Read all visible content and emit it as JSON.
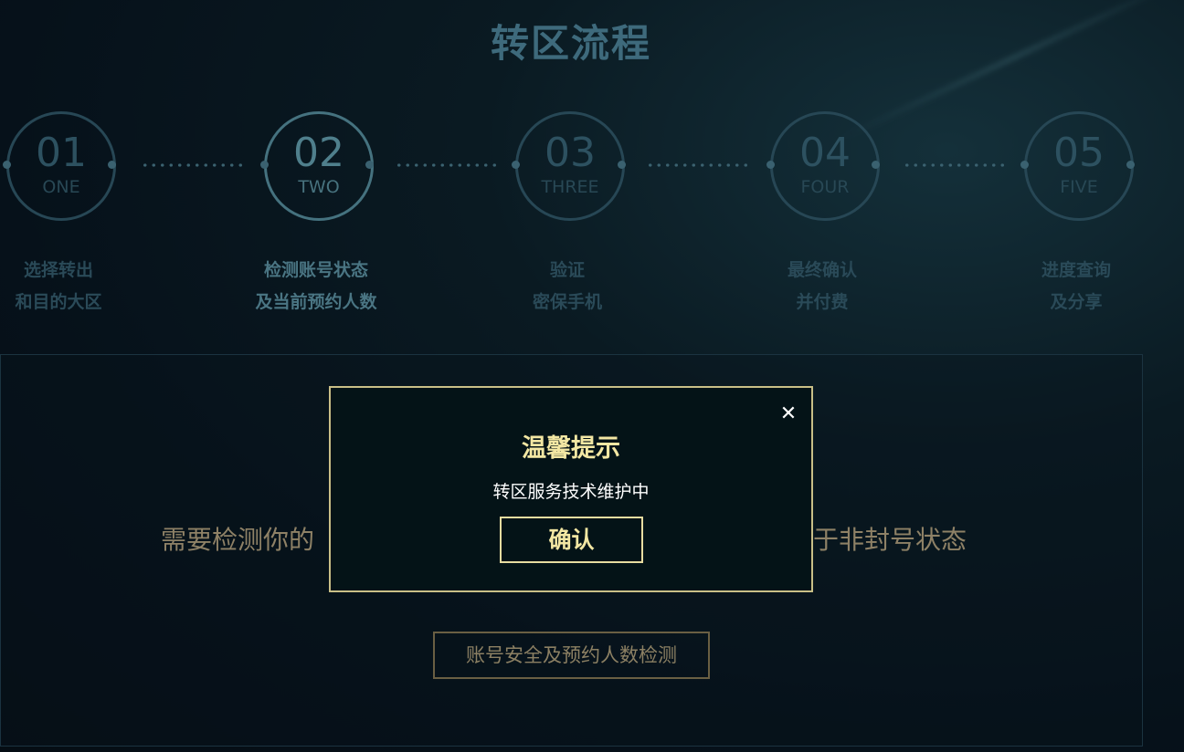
{
  "page": {
    "title": "转区流程"
  },
  "steps": [
    {
      "num": "01",
      "word": "ONE",
      "line1": "选择转出",
      "line2": "和目的大区"
    },
    {
      "num": "02",
      "word": "TWO",
      "line1": "检测账号状态",
      "line2": "及当前预约人数"
    },
    {
      "num": "03",
      "word": "THREE",
      "line1": "验证",
      "line2": "密保手机"
    },
    {
      "num": "04",
      "word": "FOUR",
      "line1": "最终确认",
      "line2": "并付费"
    },
    {
      "num": "05",
      "word": "FIVE",
      "line1": "进度查询",
      "line2": "及分享"
    }
  ],
  "panel": {
    "text_left": "需要检测你的",
    "text_right": "于非封号状态",
    "check_button": "账号安全及预约人数检测"
  },
  "modal": {
    "title": "温馨提示",
    "message": "转区服务技术维护中",
    "confirm": "确认",
    "close_icon": "close-icon"
  },
  "colors": {
    "accent_gold": "#f3e7a3",
    "modal_border": "#c9bf87",
    "step_active": "#4f7f8c",
    "step_inactive": "#2d5160"
  }
}
